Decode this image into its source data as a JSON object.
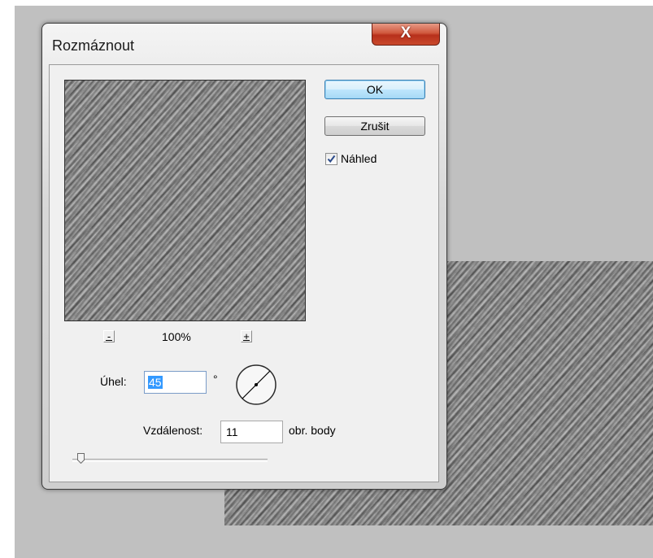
{
  "dialog": {
    "title": "Rozmáznout",
    "close_label": "X"
  },
  "buttons": {
    "ok_label": "OK",
    "cancel_label": "Zrušit"
  },
  "preview": {
    "checkbox_label": "Náhled",
    "checked": true,
    "zoom_out_label": "-",
    "zoom_in_label": "+",
    "zoom_level": "100%"
  },
  "angle": {
    "label": "Úhel:",
    "value": "45",
    "unit": "°"
  },
  "distance": {
    "label": "Vzdálenost:",
    "value": "11",
    "unit": "obr. body"
  },
  "colors": {
    "canvas_background": "#c0c0c0",
    "dialog_face": "#f0f0f0",
    "close_button": "#c9492c",
    "selection": "#3399ff"
  }
}
